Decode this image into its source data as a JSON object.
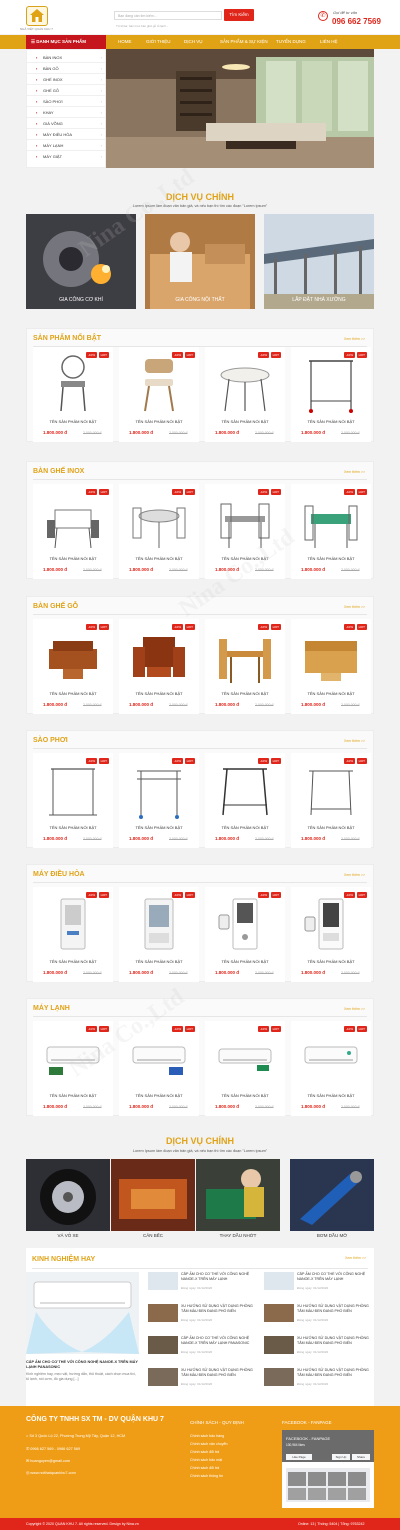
{
  "header": {
    "logo_caption": "NHÃ VIỆT QUẢN KHU 7",
    "search_placeholder": "Bạn đang cần tìm kiếm...",
    "search_button": "Tìm Kiếm",
    "search_hint": "Từ khóa: bàn inox bàn ghế gỗ tủ lạnh...",
    "hotline_label": "Gọi để tư vấn",
    "hotline": "096 662 7569"
  },
  "nav": {
    "category_title": "DANH MỤC SẢN PHẨM",
    "items": [
      "HOME",
      "GIỚI THIỆU",
      "DỊCH VỤ",
      "SẢN PHẨM & SỰ KIỆN",
      "TUYỂN DỤNG",
      "LIÊN HỆ"
    ]
  },
  "sidebar": {
    "items": [
      "BÀN INOX",
      "BÀN GỖ",
      "GHẾ INOX",
      "GHẾ GỖ",
      "SÀO PHƠI",
      "KHAY",
      "GIÁ VÕNG",
      "MÁY ĐIỀU HÒA",
      "MÁY LẠNH",
      "MÁY GIẶT"
    ]
  },
  "services": {
    "title": "DỊCH VỤ CHÍNH",
    "subtitle": "Lorem Ipsum làm đoạn văn bản giả, và nếu bạn thì tìm các đoạn \"Lorem ipsum\"",
    "items": [
      "GIA CÔNG CƠ KHÍ",
      "GIA CÔNG NỘI THẤT",
      "LẮP ĐẶT NHÀ XƯỞNG"
    ]
  },
  "product": {
    "name": "TÊN SẢN PHẨM NỔI BẬT",
    "price": "1.800.000 đ",
    "old_price": "2.000.000 đ",
    "discount": "-10%",
    "hot": "HOT",
    "see_more": "Xem thêm >>"
  },
  "sections": [
    "SẢN PHẨM NỔI BẬT",
    "BÀN GHẾ INOX",
    "BÀN GHẾ GỖ",
    "SÀO PHƠI",
    "MÁY ĐIỀU HÒA",
    "MÁY LẠNH"
  ],
  "services2": {
    "title": "DỊCH VỤ CHÍNH",
    "subtitle": "Lorem Ipsum làm đoạn văn bản giả, và nếu bạn thì tìm các đoạn \"Lorem ipsum\"",
    "items": [
      "VÁ VỎ XE",
      "CÂN BẾC",
      "THAY DẦU NHỚT",
      "BƠM DẦU MỠ"
    ]
  },
  "news": {
    "title": "KINH NGHIỆM HAY",
    "see_more": "Xem thêm >>",
    "main_title": "CẮP ẤM CHO CƠ THỂ VỚI CÔNG NGHỆ NANOE-X TRÊN MÁY LẠNH PANASONIC",
    "main_desc": "Kinh nghiệm hay, mẹo vặt, hướng dẫn, thủ thuật, cách chọn mua tivi, tủ lạnh, nồi cơm, đồ gia dụng [...]",
    "items": [
      {
        "title": "CẮP ẤM CHO CƠ THỂ VỚI CÔNG NGHỆ NANOE-X TRÊN MÁY LẠNH",
        "date": "Đăng ngày: 01/12/2020"
      },
      {
        "title": "CẮP ẤM CHO CƠ THỂ VỚI CÔNG NGHỆ NANOE-X TRÊN MÁY LẠNH",
        "date": "Đăng ngày: 01/12/2020"
      },
      {
        "title": "XU HƯỚNG SỬ DỤNG VẬT DỤNG PHÒNG TẮM MÀU ĐEN ĐANG PHỔ BIẾN",
        "date": "Đăng ngày: 01/12/2020"
      },
      {
        "title": "XU HƯỚNG SỬ DỤNG VẬT DỤNG PHÒNG TẮM MÀU ĐEN ĐANG PHỔ BIẾN",
        "date": "Đăng ngày: 01/12/2020"
      },
      {
        "title": "CẮP ẤM CHO CƠ THỂ VỚI CÔNG NGHỆ NANOE-X TRÊN MÁY LẠNH PANASONIC",
        "date": "Đăng ngày: 01/12/2020"
      },
      {
        "title": "XU HƯỚNG SỬ DỤNG VẬT DỤNG PHÒNG TẮM MÀU ĐEN ĐANG PHỔ BIẾN",
        "date": "Đăng ngày: 01/12/2020"
      },
      {
        "title": "XU HƯỚNG SỬ DỤNG VẬT DỤNG PHÒNG TẮM MÀU ĐEN ĐANG PHỔ BIẾN",
        "date": "Đăng ngày: 01/12/2020"
      },
      {
        "title": "XU HƯỚNG SỬ DỤNG VẬT DỤNG PHÒNG TẮM MÀU ĐEN ĐANG PHỔ BIẾN",
        "date": "Đăng ngày: 01/12/2020"
      }
    ]
  },
  "footer": {
    "company": "CÔNG TY TNHH SX TM - DV QUẬN KHU 7",
    "address": "Số 3 Quốc Lộ 22, Phường Trung Mỹ Tây, Quận 12, HCM",
    "phone": "0966 627 569 - 0966 627 569",
    "email": "hoanguyen@gmail.com",
    "website": "www.noithatquankhu7.com",
    "policy_title": "CHÍNH SÁCH - QUY ĐỊNH",
    "policies": [
      "Chính sách bảo hàng",
      "Chính sách vận chuyển",
      "Chính sách đổi trả",
      "Chính sách bảo mật",
      "Chính sách đổi trả",
      "Chính sách thông tin"
    ],
    "fb_title": "FACEBOOK - FANPAGE",
    "fb_page": "FACEBOOK - FANPAGE",
    "fb_likes": "130,964 likes",
    "fb_like_btn": "Like Page",
    "fb_signup": "Sign Up",
    "fb_share": "Share"
  },
  "copyright": {
    "text": "Copyright © 2020 QUAN KHU 7. All rights reserved. Design by Nina.vn",
    "stats": "Online: 13  |  Thống: 5404  |  Tổng: 9763242"
  },
  "watermark": "Nina Co.,Ltd",
  "colors": {
    "brand": "#e0a316",
    "red": "#e0261b",
    "dark_red": "#c4161c"
  }
}
